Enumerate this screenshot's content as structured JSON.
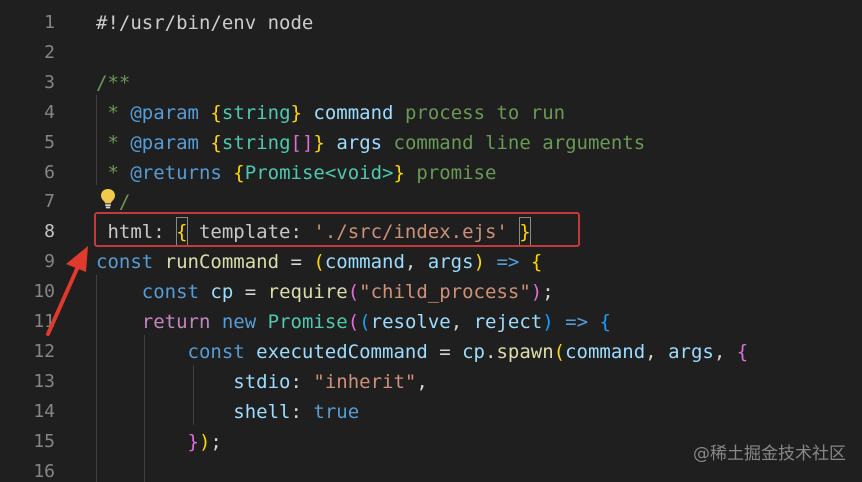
{
  "editor": {
    "lines": [
      {
        "number": "1",
        "tokens": [
          {
            "t": "#!/usr/bin/env node",
            "c": "t-gray"
          }
        ]
      },
      {
        "number": "2",
        "tokens": []
      },
      {
        "number": "3",
        "tokens": [
          {
            "t": "/**",
            "c": "t-comment"
          }
        ]
      },
      {
        "number": "4",
        "tokens": [
          {
            "t": " * ",
            "c": "t-comment"
          },
          {
            "t": "@param",
            "c": "t-tag"
          },
          {
            "t": " ",
            "c": "t-comment"
          },
          {
            "t": "{",
            "c": "t-b1"
          },
          {
            "t": "string",
            "c": "t-type"
          },
          {
            "t": "}",
            "c": "t-b1"
          },
          {
            "t": " ",
            "c": "t-comment"
          },
          {
            "t": "command",
            "c": "t-pname"
          },
          {
            "t": " process to run",
            "c": "t-comment"
          }
        ]
      },
      {
        "number": "5",
        "tokens": [
          {
            "t": " * ",
            "c": "t-comment"
          },
          {
            "t": "@param",
            "c": "t-tag"
          },
          {
            "t": " ",
            "c": "t-comment"
          },
          {
            "t": "{",
            "c": "t-b1"
          },
          {
            "t": "string",
            "c": "t-type"
          },
          {
            "t": "[]",
            "c": "t-b2"
          },
          {
            "t": "}",
            "c": "t-b1"
          },
          {
            "t": " ",
            "c": "t-comment"
          },
          {
            "t": "args",
            "c": "t-pname"
          },
          {
            "t": " command line arguments",
            "c": "t-comment"
          }
        ]
      },
      {
        "number": "6",
        "tokens": [
          {
            "t": " * ",
            "c": "t-comment"
          },
          {
            "t": "@returns",
            "c": "t-tag"
          },
          {
            "t": " ",
            "c": "t-comment"
          },
          {
            "t": "{",
            "c": "t-b1"
          },
          {
            "t": "Promise<void>",
            "c": "t-type"
          },
          {
            "t": "}",
            "c": "t-b1"
          },
          {
            "t": " promise",
            "c": "t-comment"
          }
        ]
      },
      {
        "number": "7",
        "tokens": [
          {
            "t": "  /",
            "c": "t-comment"
          }
        ]
      },
      {
        "number": "8",
        "tokens": [
          {
            "t": " html: ",
            "c": "t-lightkey"
          },
          {
            "t": "{",
            "c": "t-b1",
            "box": true
          },
          {
            "t": " template: ",
            "c": "t-lightkey"
          },
          {
            "t": "'./src/index.ejs'",
            "c": "t-str"
          },
          {
            "t": " ",
            "c": "t-plain"
          },
          {
            "t": "}",
            "c": "t-b1",
            "box": true
          }
        ]
      },
      {
        "number": "9",
        "tokens": [
          {
            "t": "const",
            "c": "t-kw"
          },
          {
            "t": " ",
            "c": "t-plain"
          },
          {
            "t": "runCommand",
            "c": "t-fn"
          },
          {
            "t": " = ",
            "c": "t-plain"
          },
          {
            "t": "(",
            "c": "t-b1"
          },
          {
            "t": "command",
            "c": "t-var"
          },
          {
            "t": ", ",
            "c": "t-plain"
          },
          {
            "t": "args",
            "c": "t-var"
          },
          {
            "t": ")",
            "c": "t-b1"
          },
          {
            "t": " ",
            "c": "t-plain"
          },
          {
            "t": "=>",
            "c": "t-kw"
          },
          {
            "t": " ",
            "c": "t-plain"
          },
          {
            "t": "{",
            "c": "t-b1"
          }
        ]
      },
      {
        "number": "10",
        "tokens": [
          {
            "t": "    ",
            "c": "t-plain"
          },
          {
            "t": "const",
            "c": "t-kw"
          },
          {
            "t": " ",
            "c": "t-plain"
          },
          {
            "t": "cp",
            "c": "t-var"
          },
          {
            "t": " = ",
            "c": "t-plain"
          },
          {
            "t": "require",
            "c": "t-fn"
          },
          {
            "t": "(",
            "c": "t-b2"
          },
          {
            "t": "\"child_process\"",
            "c": "t-str"
          },
          {
            "t": ")",
            "c": "t-b2"
          },
          {
            "t": ";",
            "c": "t-plain"
          }
        ]
      },
      {
        "number": "11",
        "tokens": [
          {
            "t": "    ",
            "c": "t-plain"
          },
          {
            "t": "return",
            "c": "t-ctrl"
          },
          {
            "t": " ",
            "c": "t-plain"
          },
          {
            "t": "new",
            "c": "t-kw"
          },
          {
            "t": " ",
            "c": "t-plain"
          },
          {
            "t": "Promise",
            "c": "t-cls"
          },
          {
            "t": "(",
            "c": "t-b2"
          },
          {
            "t": "(",
            "c": "t-b3"
          },
          {
            "t": "resolve",
            "c": "t-var"
          },
          {
            "t": ", ",
            "c": "t-plain"
          },
          {
            "t": "reject",
            "c": "t-var"
          },
          {
            "t": ")",
            "c": "t-b3"
          },
          {
            "t": " ",
            "c": "t-plain"
          },
          {
            "t": "=>",
            "c": "t-kw"
          },
          {
            "t": " ",
            "c": "t-plain"
          },
          {
            "t": "{",
            "c": "t-b3"
          }
        ]
      },
      {
        "number": "12",
        "tokens": [
          {
            "t": "        ",
            "c": "t-plain"
          },
          {
            "t": "const",
            "c": "t-kw"
          },
          {
            "t": " ",
            "c": "t-plain"
          },
          {
            "t": "executedCommand",
            "c": "t-var"
          },
          {
            "t": " = ",
            "c": "t-plain"
          },
          {
            "t": "cp",
            "c": "t-var"
          },
          {
            "t": ".",
            "c": "t-plain"
          },
          {
            "t": "spawn",
            "c": "t-fn"
          },
          {
            "t": "(",
            "c": "t-b1"
          },
          {
            "t": "command",
            "c": "t-var"
          },
          {
            "t": ", ",
            "c": "t-plain"
          },
          {
            "t": "args",
            "c": "t-var"
          },
          {
            "t": ", ",
            "c": "t-plain"
          },
          {
            "t": "{",
            "c": "t-b2"
          }
        ]
      },
      {
        "number": "13",
        "tokens": [
          {
            "t": "            ",
            "c": "t-plain"
          },
          {
            "t": "stdio",
            "c": "t-var"
          },
          {
            "t": ": ",
            "c": "t-plain"
          },
          {
            "t": "\"inherit\"",
            "c": "t-str"
          },
          {
            "t": ",",
            "c": "t-plain"
          }
        ]
      },
      {
        "number": "14",
        "tokens": [
          {
            "t": "            ",
            "c": "t-plain"
          },
          {
            "t": "shell",
            "c": "t-var"
          },
          {
            "t": ": ",
            "c": "t-plain"
          },
          {
            "t": "true",
            "c": "t-kw"
          }
        ]
      },
      {
        "number": "15",
        "tokens": [
          {
            "t": "        ",
            "c": "t-plain"
          },
          {
            "t": "}",
            "c": "t-b2"
          },
          {
            "t": ")",
            "c": "t-b1"
          },
          {
            "t": ";",
            "c": "t-plain"
          }
        ]
      },
      {
        "number": "16",
        "tokens": []
      }
    ],
    "active_line": "8"
  },
  "watermark": "@稀土掘金技术社区",
  "colors": {
    "background": "#1f1f1f",
    "highlight_border": "#c43a3a",
    "arrow": "#e03a2f"
  },
  "icons": {
    "lightbulb": "lightbulb-icon",
    "arrow": "red-arrow-icon"
  }
}
